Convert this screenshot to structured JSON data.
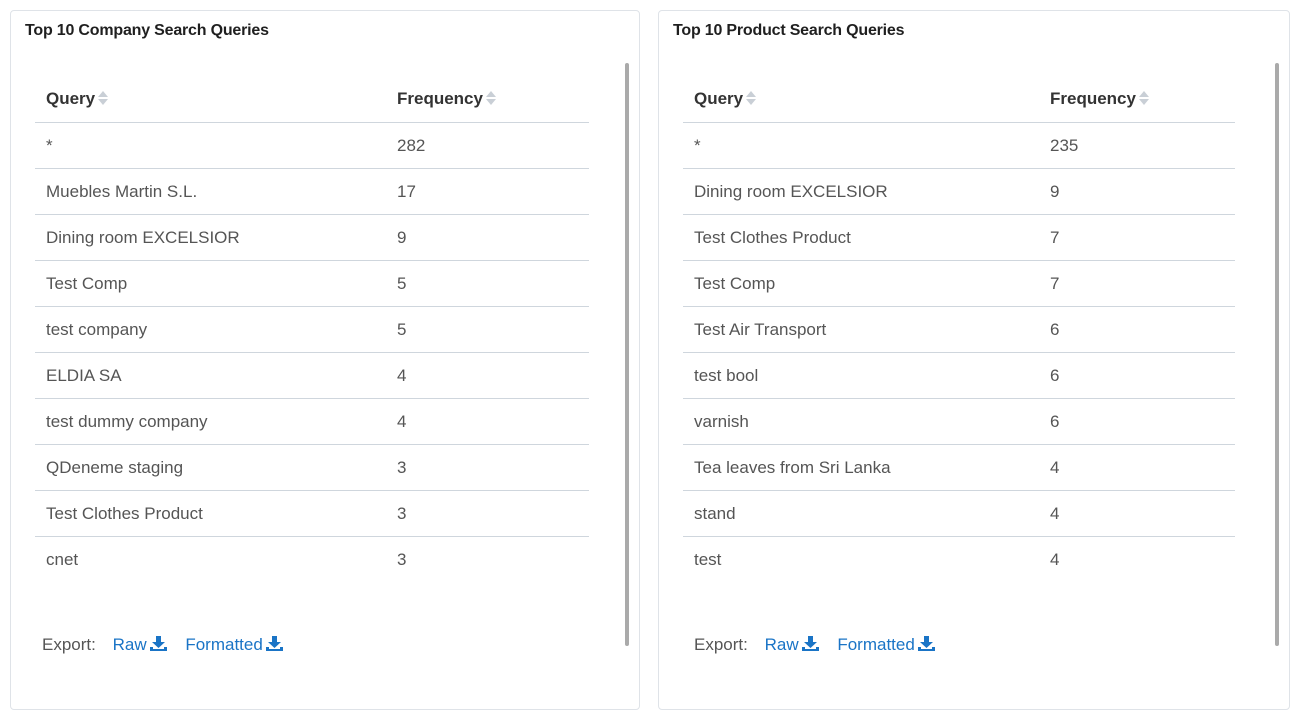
{
  "panels": [
    {
      "title": "Top 10 Company Search Queries",
      "columns": [
        "Query",
        "Frequency"
      ],
      "rows": [
        {
          "query": "*",
          "frequency": "282"
        },
        {
          "query": "Muebles Martin S.L.",
          "frequency": "17"
        },
        {
          "query": "Dining room EXCELSIOR",
          "frequency": "9"
        },
        {
          "query": "Test Comp",
          "frequency": "5"
        },
        {
          "query": "test company",
          "frequency": "5"
        },
        {
          "query": "ELDIA SA",
          "frequency": "4"
        },
        {
          "query": "test dummy company",
          "frequency": "4"
        },
        {
          "query": "QDeneme staging",
          "frequency": "3"
        },
        {
          "query": "Test Clothes Product",
          "frequency": "3"
        },
        {
          "query": "cnet",
          "frequency": "3"
        }
      ],
      "export": {
        "label": "Export:",
        "raw": "Raw",
        "formatted": "Formatted"
      }
    },
    {
      "title": "Top 10 Product Search Queries",
      "columns": [
        "Query",
        "Frequency"
      ],
      "rows": [
        {
          "query": "*",
          "frequency": "235"
        },
        {
          "query": "Dining room EXCELSIOR",
          "frequency": "9"
        },
        {
          "query": "Test Clothes Product",
          "frequency": "7"
        },
        {
          "query": "Test Comp",
          "frequency": "7"
        },
        {
          "query": "Test Air Transport",
          "frequency": "6"
        },
        {
          "query": "test bool",
          "frequency": "6"
        },
        {
          "query": "varnish",
          "frequency": "6"
        },
        {
          "query": "Tea leaves from Sri Lanka",
          "frequency": "4"
        },
        {
          "query": "stand",
          "frequency": "4"
        },
        {
          "query": "test",
          "frequency": "4"
        }
      ],
      "export": {
        "label": "Export:",
        "raw": "Raw",
        "formatted": "Formatted"
      }
    }
  ],
  "icons": {
    "sort": "sort-icon",
    "download": "download-icon"
  },
  "colors": {
    "link": "#1a74c6",
    "title": "#1f1f1f",
    "text": "#555555",
    "divider": "#cfd6dd"
  }
}
